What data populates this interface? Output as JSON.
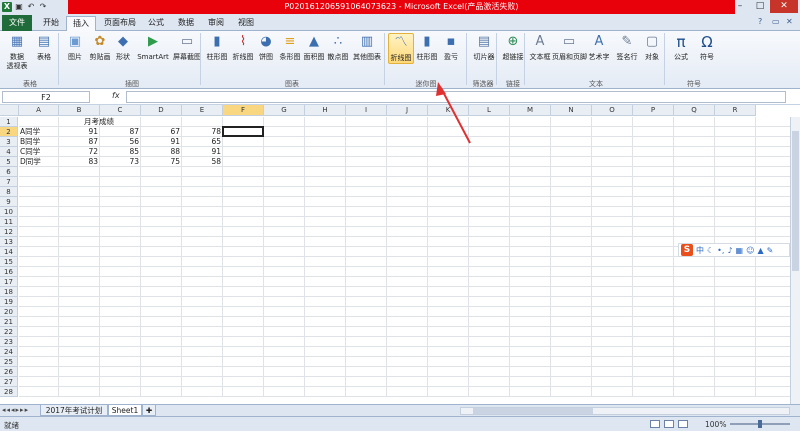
{
  "window": {
    "title": "P020161206591064073623 - Microsoft Excel(产品激活失败)",
    "app_icon": "X",
    "qat_icons": [
      "save-icon",
      "undo-icon",
      "redo-icon"
    ],
    "controls": [
      "–",
      "□",
      "✕"
    ]
  },
  "tabs": [
    {
      "label": "文件",
      "file": true
    },
    {
      "label": "开始"
    },
    {
      "label": "插入",
      "active": true
    },
    {
      "label": "页面布局"
    },
    {
      "label": "公式"
    },
    {
      "label": "数据"
    },
    {
      "label": "审阅"
    },
    {
      "label": "视图"
    }
  ],
  "ribbon": {
    "buttons": [
      {
        "label": "数据",
        "label2": "透视表",
        "icon": "pivot-table-icon",
        "color": "#4a78b8"
      },
      {
        "label": "表格",
        "icon": "table-icon",
        "color": "#4a78b8"
      },
      {
        "label": "图片",
        "icon": "picture-icon",
        "color": "#6b9bd1"
      },
      {
        "label": "剪贴画",
        "icon": "clipart-icon",
        "color": "#c48b2c"
      },
      {
        "label": "形状",
        "icon": "shapes-icon",
        "color": "#3d6fb0"
      },
      {
        "label": "SmartArt",
        "icon": "smartart-icon",
        "color": "#2f9b4c"
      },
      {
        "label": "屏幕截图",
        "icon": "screenshot-icon",
        "color": "#6b7c94"
      },
      {
        "label": "柱形图",
        "icon": "column-chart-icon",
        "color": "#3d6fb0"
      },
      {
        "label": "折线图",
        "icon": "line-chart-icon",
        "color": "#c03030"
      },
      {
        "label": "饼图",
        "icon": "pie-chart-icon",
        "color": "#3d6fb0"
      },
      {
        "label": "条形图",
        "icon": "bar-chart-icon",
        "color": "#e0a020"
      },
      {
        "label": "面积图",
        "icon": "area-chart-icon",
        "color": "#3d6fb0"
      },
      {
        "label": "散点图",
        "icon": "scatter-chart-icon",
        "color": "#3d6fb0"
      },
      {
        "label": "其他图表",
        "icon": "other-charts-icon",
        "color": "#3d6fb0"
      },
      {
        "label": "折线图",
        "icon": "sparkline-line-icon",
        "color": "#3d6fb0",
        "selected": true
      },
      {
        "label": "柱形图",
        "icon": "sparkline-column-icon",
        "color": "#3d6fb0"
      },
      {
        "label": "盈亏",
        "icon": "sparkline-winloss-icon",
        "color": "#3d6fb0"
      },
      {
        "label": "切片器",
        "icon": "slicer-icon",
        "color": "#5a7ca8"
      },
      {
        "label": "超链接",
        "icon": "hyperlink-icon",
        "color": "#2e8b57"
      },
      {
        "label": "文本框",
        "icon": "textbox-icon",
        "color": "#6b7c94"
      },
      {
        "label": "页眉和页脚",
        "icon": "header-footer-icon",
        "color": "#6b7c94"
      },
      {
        "label": "艺术字",
        "icon": "wordart-icon",
        "color": "#3d6fb0"
      },
      {
        "label": "签名行",
        "icon": "signature-icon",
        "color": "#6b7c94"
      },
      {
        "label": "对象",
        "icon": "object-icon",
        "color": "#6b7c94"
      },
      {
        "label": "公式",
        "icon": "equation-icon",
        "color": "#1f4e8c",
        "glyph": "π"
      },
      {
        "label": "符号",
        "icon": "symbol-icon",
        "color": "#1f4e8c",
        "glyph": "Ω"
      }
    ],
    "groups": [
      "表格",
      "插图",
      "图表",
      "迷你图",
      "筛选器",
      "链接",
      "文本",
      "符号"
    ]
  },
  "formula_bar": {
    "name_box": "F2",
    "fx": "fx",
    "value": ""
  },
  "sheet": {
    "columns": [
      "A",
      "B",
      "C",
      "D",
      "E",
      "F",
      "G",
      "H",
      "I",
      "J",
      "K",
      "L",
      "M",
      "N",
      "O",
      "P",
      "Q",
      "R"
    ],
    "rows": [
      "1",
      "2",
      "3",
      "4",
      "5",
      "6",
      "7",
      "8",
      "9",
      "10",
      "11",
      "12",
      "13",
      "14",
      "15",
      "16",
      "17",
      "18",
      "19",
      "20",
      "21",
      "22",
      "23",
      "24",
      "25",
      "26",
      "27",
      "28"
    ],
    "title": "月考成绩",
    "data": [
      [
        "A同学",
        "91",
        "87",
        "67",
        "78"
      ],
      [
        "B同学",
        "87",
        "56",
        "91",
        "65"
      ],
      [
        "C同学",
        "72",
        "85",
        "88",
        "91"
      ],
      [
        "D同学",
        "83",
        "73",
        "75",
        "58"
      ]
    ],
    "selected_column": "F",
    "selected_row": "2"
  },
  "sheet_tabs": [
    "2017年考试计划",
    "Sheet1"
  ],
  "status": {
    "ready": "就绪",
    "zoom": "100%"
  },
  "ime": {
    "logo": "S",
    "mode": "中"
  },
  "colors": {
    "titlebar_red": "#e8000b",
    "file_tab": "#1f6c3a",
    "selected_header": "#f8d780",
    "arrow": "#e03030"
  }
}
